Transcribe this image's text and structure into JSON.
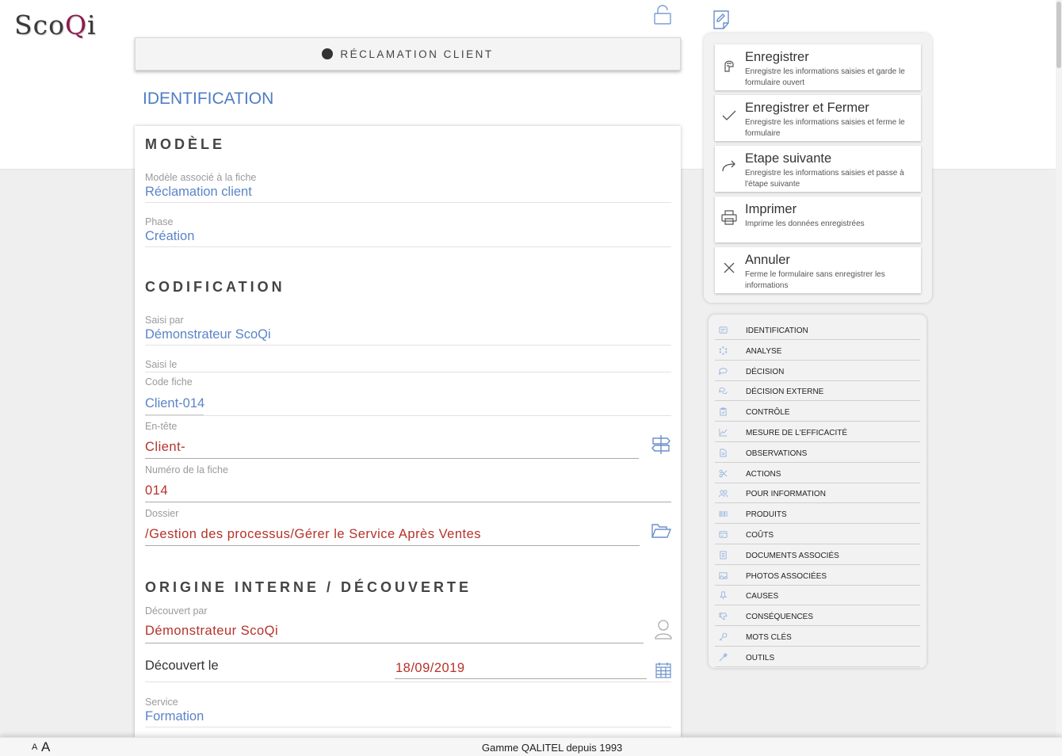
{
  "app": {
    "logo_prefix": "Sco",
    "logo_q": "Q",
    "logo_suffix": "i"
  },
  "header": {
    "form_title": "RÉCLAMATION CLIENT",
    "lock_icon": "lock-icon",
    "note_icon": "edit-note-icon"
  },
  "main": {
    "section_heading": "IDENTIFICATION",
    "modele": {
      "title": "MODÈLE",
      "model_label": "Modèle associé à la fiche",
      "model_value": "Réclamation client",
      "phase_label": "Phase",
      "phase_value": "Création"
    },
    "codification": {
      "title": "CODIFICATION",
      "saisi_par_label": "Saisi par",
      "saisi_par_value": "Démonstrateur ScoQi",
      "saisi_le_label": "Saisi le",
      "code_label": "Code fiche",
      "code_value": "Client-014",
      "entete_label": "En-tête",
      "entete_value": "Client-",
      "numero_label": "Numéro de la fiche",
      "numero_value": "014",
      "dossier_label": "Dossier",
      "dossier_value": "/Gestion des processus/Gérer le Service Après Ventes"
    },
    "origine": {
      "title": "ORIGINE INTERNE / DÉCOUVERTE",
      "decouvert_par_label": "Découvert par",
      "decouvert_par_value": "Démonstrateur ScoQi",
      "decouvert_le_label": "Découvert le",
      "decouvert_le_value": "18/09/2019",
      "service_label": "Service",
      "service_value": "Formation"
    }
  },
  "actions": [
    {
      "title": "Enregistrer",
      "desc": "Enregistre les informations saisies et garde le formulaire ouvert",
      "icon": "save-hand-icon"
    },
    {
      "title": "Enregistrer et Fermer",
      "desc": "Enregistre les informations saisies et ferme le formulaire",
      "icon": "check-icon"
    },
    {
      "title": "Etape suivante",
      "desc": "Enregistre les informations saisies et passe à l'étape suivante",
      "icon": "forward-arrow-icon"
    },
    {
      "title": "Imprimer",
      "desc": "Imprime les données enregistrées",
      "icon": "printer-icon"
    },
    {
      "title": "Annuler",
      "desc": "Ferme le formulaire sans enregistrer les informations",
      "icon": "close-icon"
    }
  ],
  "nav": [
    {
      "label": "IDENTIFICATION",
      "icon": "id-card-icon"
    },
    {
      "label": "ANALYSE",
      "icon": "spinner-icon"
    },
    {
      "label": "DÉCISION",
      "icon": "speech-bubble-icon"
    },
    {
      "label": "DÉCISION EXTERNE",
      "icon": "chat-bubbles-icon"
    },
    {
      "label": "CONTRÔLE",
      "icon": "clipboard-check-icon"
    },
    {
      "label": "MESURE DE L'EFFICACITÉ",
      "icon": "line-chart-icon"
    },
    {
      "label": "OBSERVATIONS",
      "icon": "document-icon"
    },
    {
      "label": "ACTIONS",
      "icon": "scissors-icon"
    },
    {
      "label": "POUR INFORMATION",
      "icon": "users-icon"
    },
    {
      "label": "PRODUITS",
      "icon": "barcode-icon"
    },
    {
      "label": "COÛTS",
      "icon": "credit-card-icon"
    },
    {
      "label": "DOCUMENTS ASSOCIÉS",
      "icon": "file-icon"
    },
    {
      "label": "PHOTOS ASSOCIÉES",
      "icon": "image-icon"
    },
    {
      "label": "CAUSES",
      "icon": "pin-icon"
    },
    {
      "label": "CONSÉQUENCES",
      "icon": "thumbs-down-icon"
    },
    {
      "label": "MOTS CLÉS",
      "icon": "key-icon"
    },
    {
      "label": "OUTILS",
      "icon": "wrench-icon"
    }
  ],
  "footer": {
    "font_small": "A",
    "font_large": "A",
    "text": "Gamme QALITEL depuis 1993"
  },
  "colors": {
    "accent_blue": "#5b84c8",
    "value_red": "#b5322a",
    "brand": "#8e1a4d"
  }
}
